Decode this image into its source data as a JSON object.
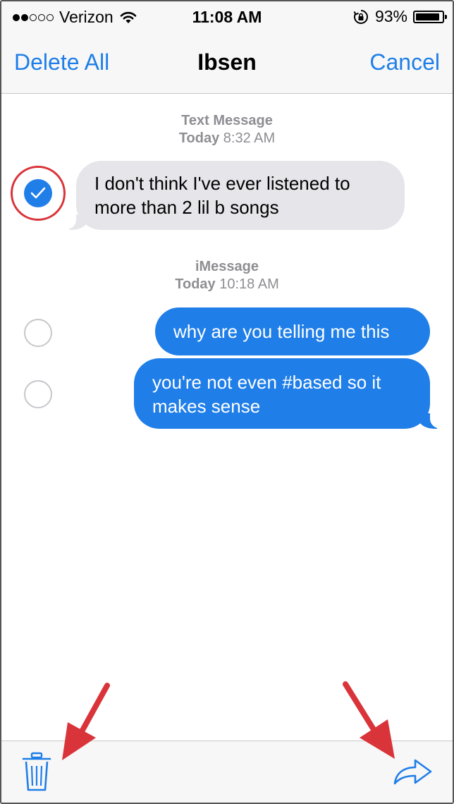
{
  "status_bar": {
    "carrier": "Verizon",
    "time": "11:08 AM",
    "battery": "93%",
    "battery_level": 0.93,
    "signal_bars_filled": 2,
    "signal_bars_total": 5
  },
  "nav": {
    "left_label": "Delete All",
    "title": "Ibsen",
    "right_label": "Cancel"
  },
  "groups": [
    {
      "kind": "Text Message",
      "date": "Today",
      "time": "8:32 AM"
    },
    {
      "kind": "iMessage",
      "date": "Today",
      "time": "10:18 AM"
    }
  ],
  "messages": [
    {
      "text": "I don't think I've ever listened to more than 2 lil b songs",
      "direction": "incoming",
      "selected": true
    },
    {
      "text": "why are you telling me this",
      "direction": "outgoing",
      "selected": false
    },
    {
      "text": "you're not even #based so it makes sense",
      "direction": "outgoing",
      "selected": false
    }
  ],
  "toolbar": {
    "delete_icon": "trash-icon",
    "forward_icon": "forward-icon"
  },
  "colors": {
    "accent": "#1f7ee8",
    "incoming_bubble": "#e5e5ea",
    "annotation_red": "#d9343a"
  }
}
